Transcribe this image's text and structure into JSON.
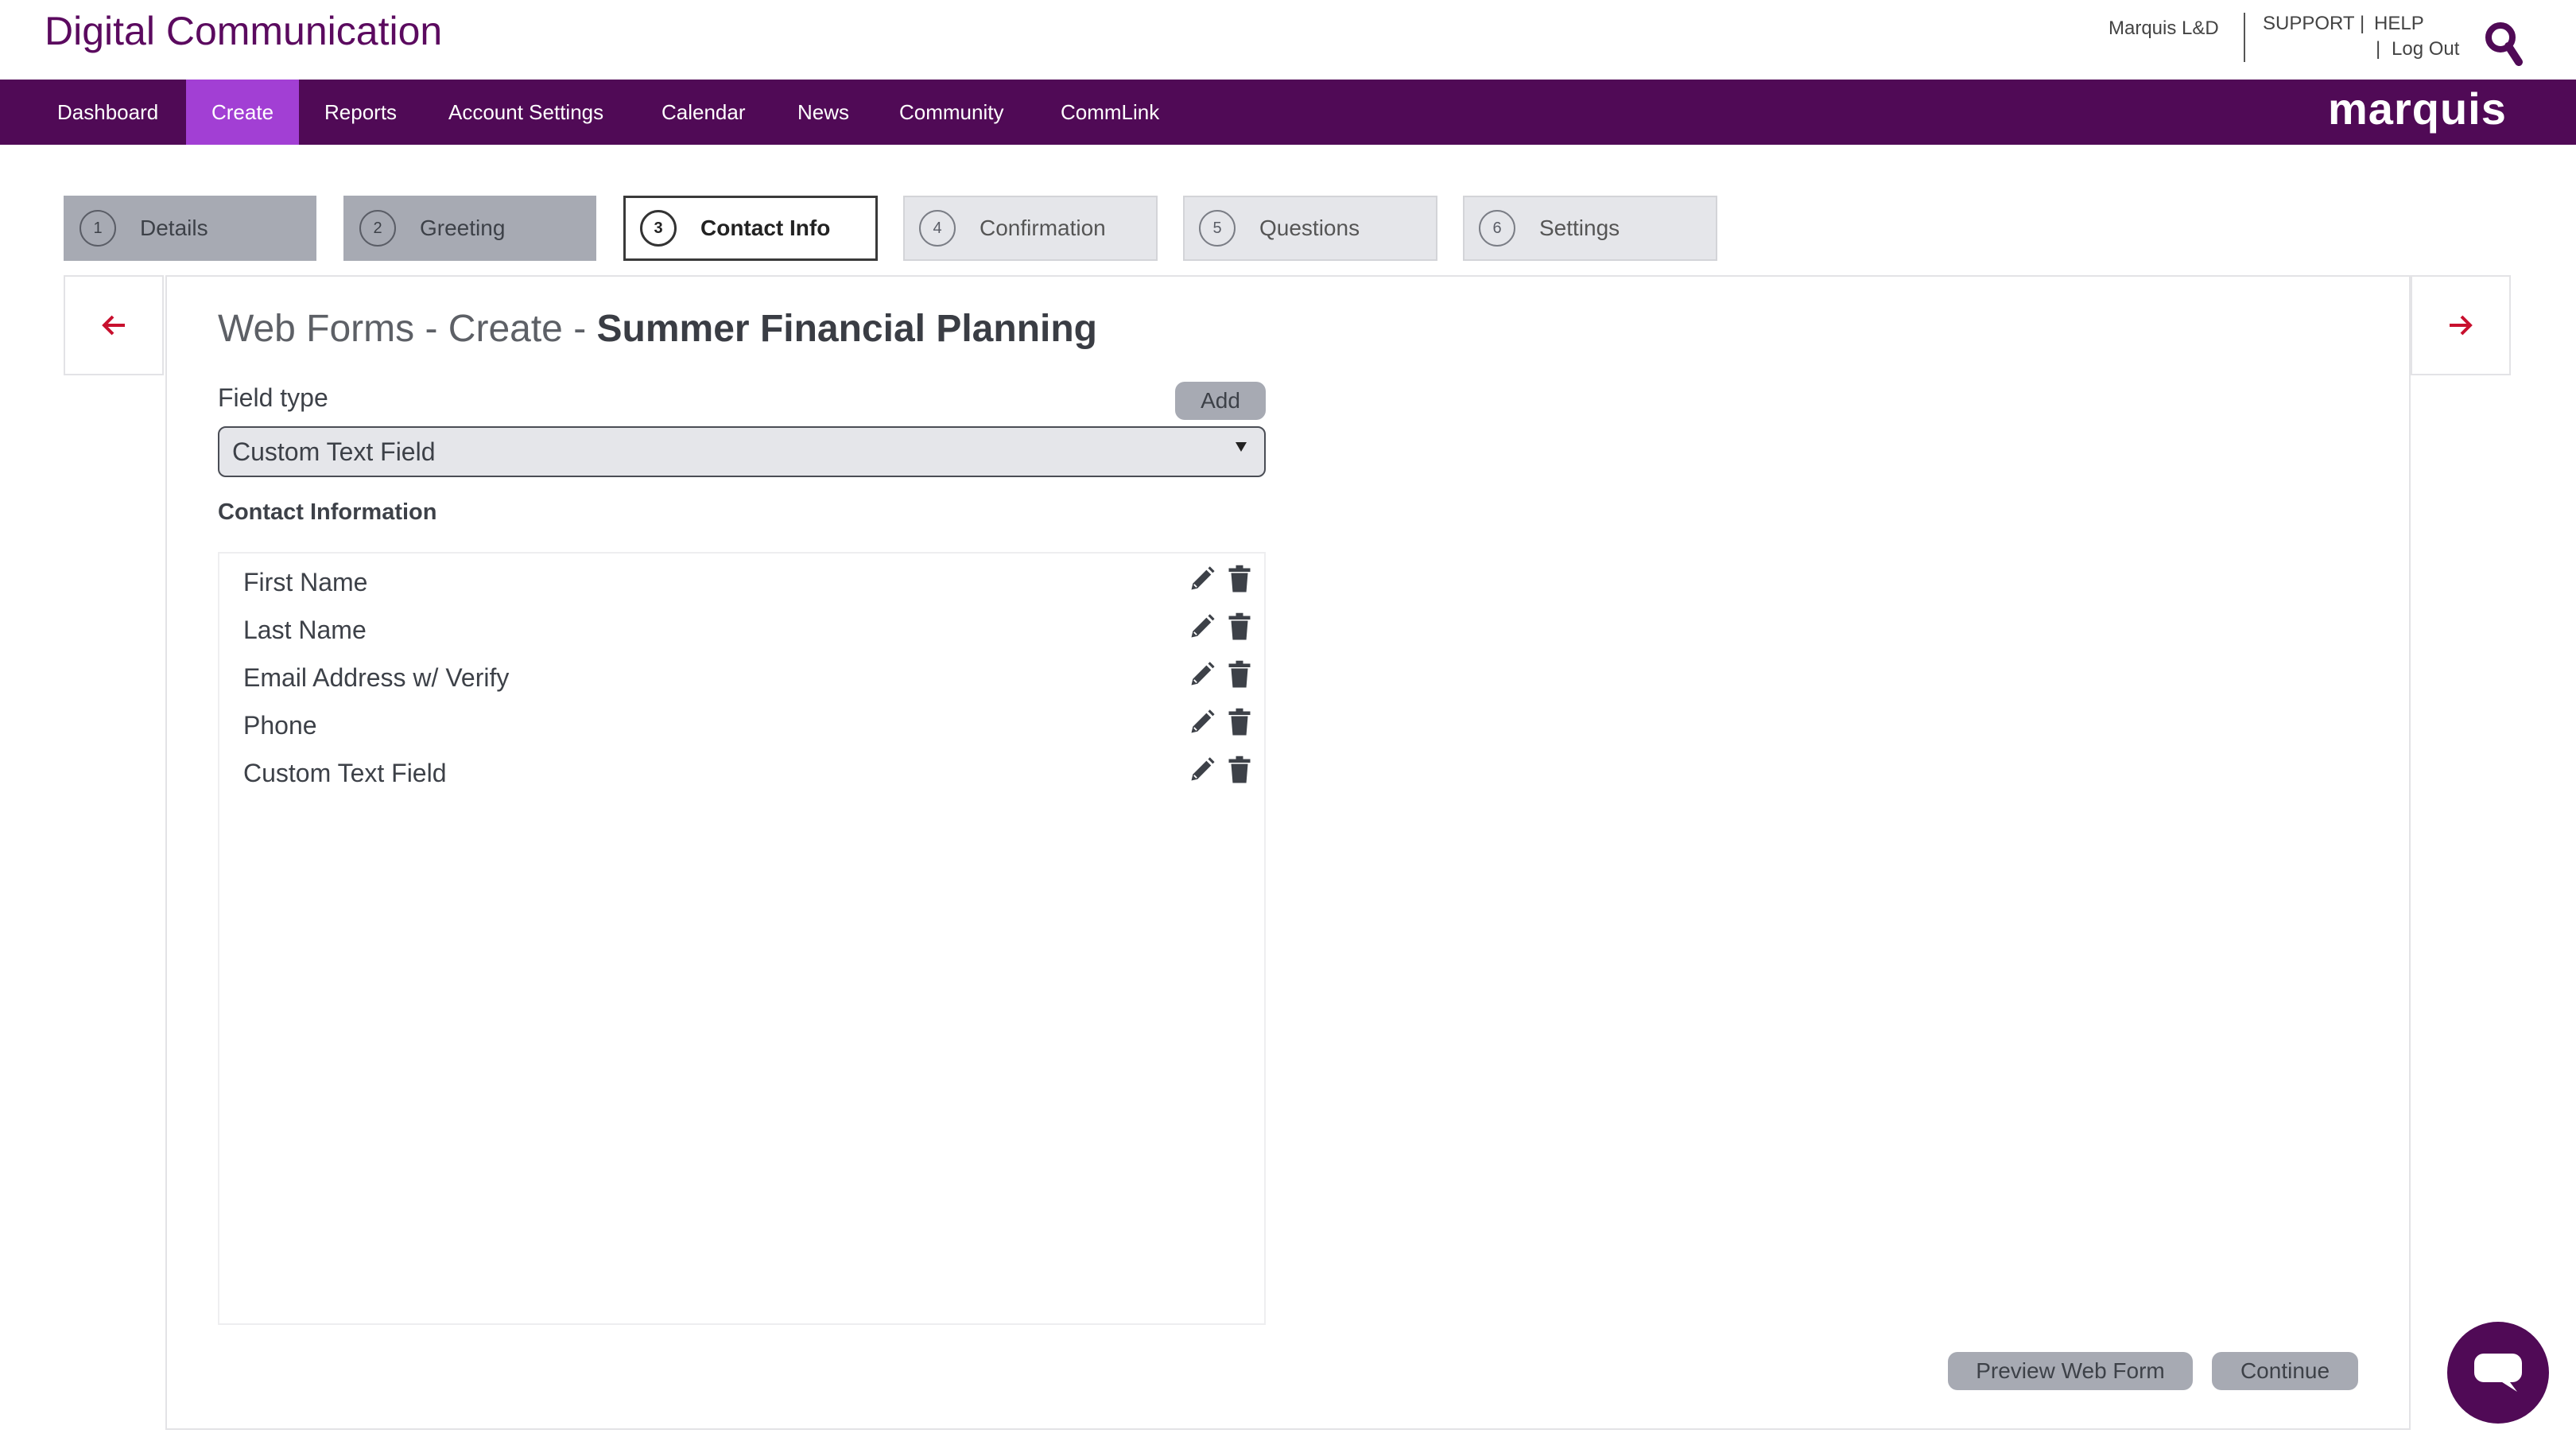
{
  "header": {
    "app_title": "Digital Communication",
    "user_name": "Marquis L&D",
    "support": "SUPPORT",
    "separator": "|",
    "help": "HELP",
    "logout": "Log Out"
  },
  "nav": {
    "items": [
      {
        "label": "Dashboard"
      },
      {
        "label": "Create",
        "active": true
      },
      {
        "label": "Reports"
      },
      {
        "label": "Account Settings"
      },
      {
        "label": "Calendar"
      },
      {
        "label": "News"
      },
      {
        "label": "Community"
      },
      {
        "label": "CommLink"
      }
    ],
    "brand": "marquis"
  },
  "steps": [
    {
      "num": "1",
      "label": "Details",
      "state": "done"
    },
    {
      "num": "2",
      "label": "Greeting",
      "state": "done"
    },
    {
      "num": "3",
      "label": "Contact Info",
      "state": "active"
    },
    {
      "num": "4",
      "label": "Confirmation",
      "state": "pending"
    },
    {
      "num": "5",
      "label": "Questions",
      "state": "pending"
    },
    {
      "num": "6",
      "label": "Settings",
      "state": "pending"
    }
  ],
  "page": {
    "title_prefix": "Web Forms - Create - ",
    "title_name": "Summer Financial Planning"
  },
  "form": {
    "field_type_label": "Field type",
    "add_label": "Add",
    "selected_field_type": "Custom Text Field",
    "contact_heading": "Contact Information",
    "fields": [
      "First Name",
      "Last Name",
      "Email Address w/ Verify",
      "Phone",
      "Custom Text Field"
    ]
  },
  "actions": {
    "preview_label": "Preview Web Form",
    "continue_label": "Continue"
  },
  "icons": {
    "arrow_left": "arrow-left-icon",
    "arrow_right": "arrow-right-icon",
    "edit": "pencil-icon",
    "delete": "trash-icon",
    "search": "search-icon",
    "chat": "chat-icon"
  },
  "colors": {
    "brand_purple": "#500a56",
    "nav_active": "#a23fd4",
    "arrow_red": "#c8102e",
    "button_gray": "#a7aab3"
  }
}
